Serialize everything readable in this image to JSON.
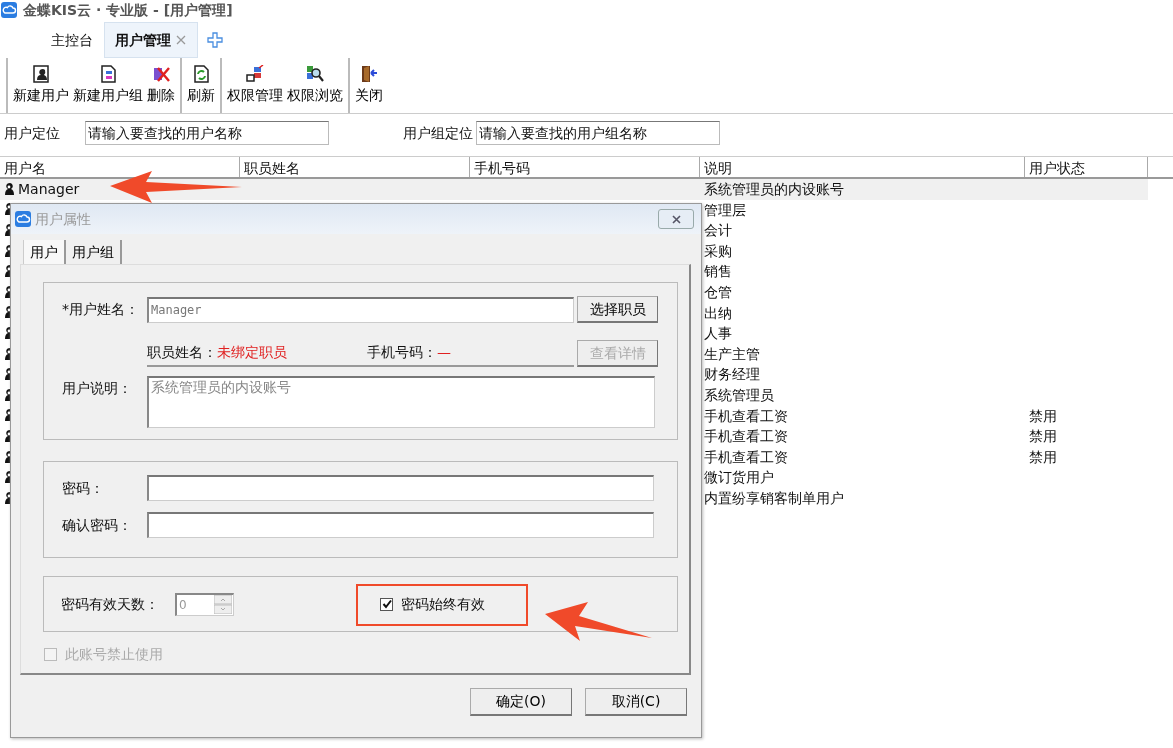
{
  "window": {
    "title": "金蝶KIS云 · 专业版 - [用户管理]"
  },
  "tabs": [
    {
      "label": "主控台",
      "selected": false,
      "closable": false
    },
    {
      "label": "用户管理",
      "selected": true,
      "closable": true
    }
  ],
  "toolbar": {
    "groups": [
      [
        "新建用户",
        "新建用户组",
        "删除"
      ],
      [
        "刷新"
      ],
      [
        "权限管理",
        "权限浏览"
      ],
      [
        "关闭"
      ]
    ]
  },
  "locators": [
    {
      "label": "用户定位",
      "placeholder": "请输入要查找的用户名称"
    },
    {
      "label": "用户组定位",
      "placeholder": "请输入要查找的用户组名称"
    }
  ],
  "table": {
    "columns": [
      "用户名",
      "职员姓名",
      "手机号码",
      "说明",
      "用户状态"
    ],
    "rows": [
      {
        "user_name": "Manager",
        "description": "系统管理员的内设账号",
        "selected": true
      },
      {
        "description": "管理层",
        "selected": false
      },
      {
        "description": "会计",
        "selected": false
      },
      {
        "description": "采购",
        "selected": false
      },
      {
        "description": "销售",
        "selected": false
      },
      {
        "description": "仓管",
        "selected": false
      },
      {
        "description": "出纳",
        "selected": false
      },
      {
        "description": "人事",
        "selected": false
      },
      {
        "description": "生产主管",
        "selected": false
      },
      {
        "description": "财务经理",
        "selected": false
      },
      {
        "description": "系统管理员",
        "selected": false
      },
      {
        "description": "手机查看工资",
        "status": "禁用",
        "selected": false
      },
      {
        "description": "手机查看工资",
        "status": "禁用",
        "selected": false
      },
      {
        "description": "手机查看工资",
        "status": "禁用",
        "selected": false
      },
      {
        "description": "微订货用户",
        "selected": false
      },
      {
        "description": "内置纷享销客制单用户",
        "selected": false
      }
    ]
  },
  "dialog": {
    "title": "用户属性",
    "tabs": [
      {
        "label": "用户",
        "selected": true
      },
      {
        "label": "用户组",
        "selected": false
      }
    ],
    "user_name": {
      "label": "*用户姓名：",
      "value": "Manager"
    },
    "select_button": {
      "label": "选择职员",
      "disabled": false
    },
    "employee": {
      "label": "职员姓名：",
      "value": "未绑定职员"
    },
    "phone": {
      "label": "手机号码：",
      "value": "—"
    },
    "details_button": {
      "label": "查看详情",
      "disabled": true
    },
    "description": {
      "label": "用户说明：",
      "value": "系统管理员的内设账号"
    },
    "password": {
      "label": "密码："
    },
    "confirm_password": {
      "label": "确认密码："
    },
    "valid_days": {
      "label": "密码有效天数：",
      "value": "0"
    },
    "always_valid": {
      "label": "密码始终有效",
      "checked": true,
      "disabled": false
    },
    "disable_account": {
      "label": "此账号禁止使用",
      "checked": false,
      "disabled": true
    },
    "buttons": [
      "确定(O)",
      "取消(C)"
    ]
  }
}
